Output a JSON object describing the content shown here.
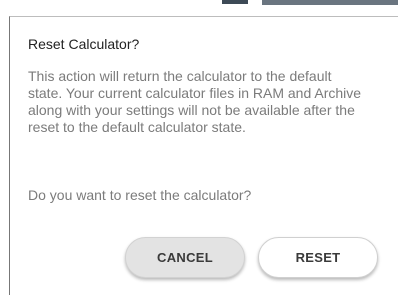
{
  "dialog": {
    "title": "Reset Calculator?",
    "message": "This action will return the calculator to the default state. Your current calculator files in RAM and Archive along with your settings will not be available after the reset to the default calculator state.",
    "question": "Do you want to reset the calculator?",
    "buttons": {
      "cancel_label": "CANCEL",
      "reset_label": "RESET"
    }
  }
}
